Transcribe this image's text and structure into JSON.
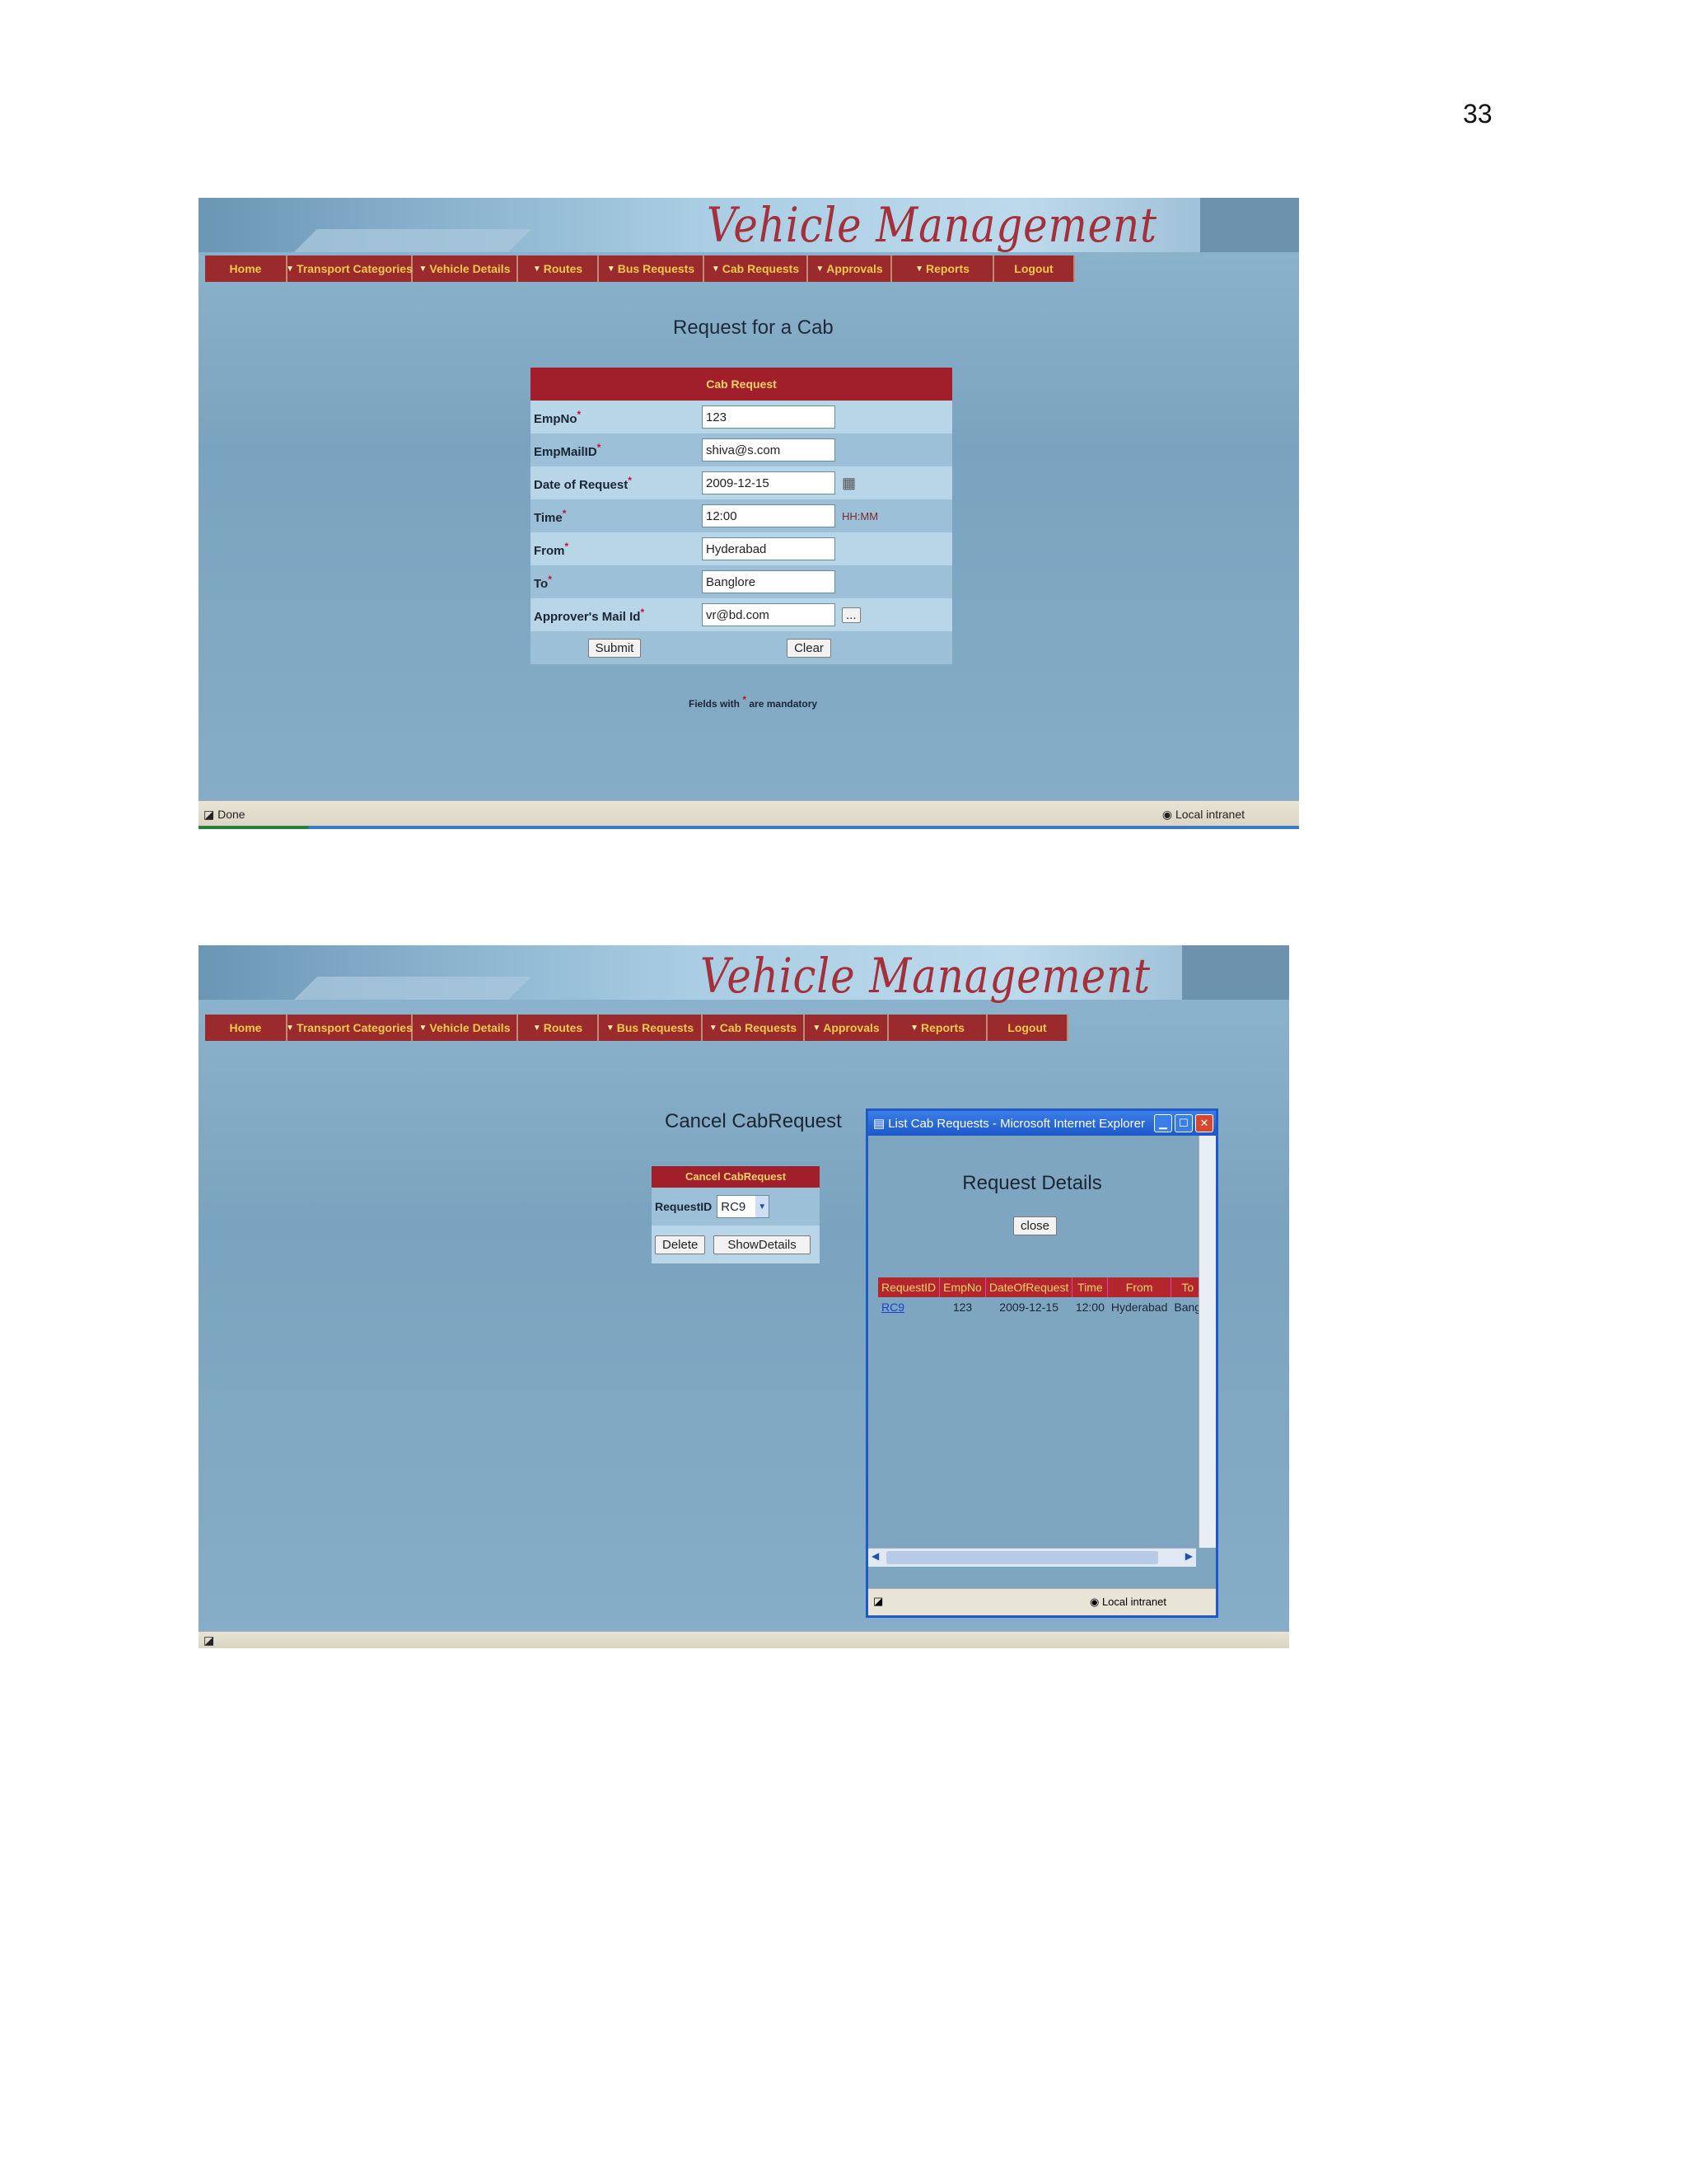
{
  "page_number": "33",
  "app": {
    "title": "Vehicle Management",
    "menu": [
      {
        "label": "Home",
        "arrow": false
      },
      {
        "label": "Transport Categories",
        "arrow": true
      },
      {
        "label": "Vehicle Details",
        "arrow": true
      },
      {
        "label": "Routes",
        "arrow": true
      },
      {
        "label": "Bus Requests",
        "arrow": true
      },
      {
        "label": "Cab Requests",
        "arrow": true
      },
      {
        "label": "Approvals",
        "arrow": true
      },
      {
        "label": "Reports",
        "arrow": true
      },
      {
        "label": "Logout",
        "arrow": false
      }
    ],
    "status_done": "Done",
    "status_zone": "Local intranet"
  },
  "screen1": {
    "title": "Request for a Cab",
    "form_header": "Cab Request",
    "fields": {
      "empno": {
        "label": "EmpNo",
        "value": "123"
      },
      "email": {
        "label": "EmpMailID",
        "value": "shiva@s.com"
      },
      "date": {
        "label": "Date of Request",
        "value": "2009-12-15"
      },
      "time": {
        "label": "Time",
        "value": "12:00",
        "hint": "HH:MM"
      },
      "from": {
        "label": "From",
        "value": "Hyderabad"
      },
      "to": {
        "label": "To",
        "value": "Banglore"
      },
      "approver": {
        "label": "Approver's Mail Id",
        "value": "vr@bd.com",
        "browse": "..."
      }
    },
    "submit_label": "Submit",
    "clear_label": "Clear",
    "mandatory_note_prefix": "Fields with",
    "mandatory_note_suffix": "are mandatory"
  },
  "screen2": {
    "title": "Cancel CabRequest",
    "form_header": "Cancel CabRequest",
    "request_id_label": "RequestID",
    "request_id_value": "RC9",
    "delete_label": "Delete",
    "show_details_label": "ShowDetails",
    "popup": {
      "window_title": "List Cab Requests - Microsoft Internet Explorer",
      "heading": "Request Details",
      "close_label": "close",
      "columns": [
        "RequestID",
        "EmpNo",
        "DateOfRequest",
        "Time",
        "From",
        "To"
      ],
      "rows": [
        [
          "RC9",
          "123",
          "2009-12-15",
          "12:00",
          "Hyderabad",
          "Bang"
        ]
      ],
      "status_zone": "Local intranet"
    }
  }
}
